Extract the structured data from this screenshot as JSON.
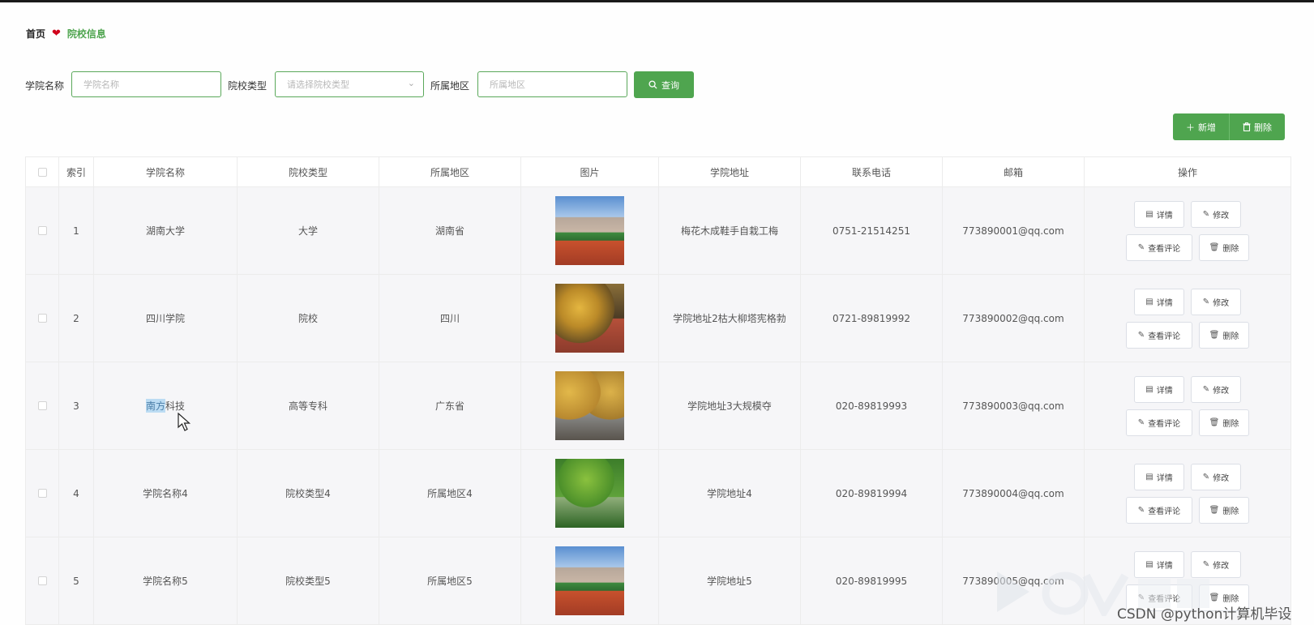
{
  "breadcrumb": {
    "home": "首页",
    "current": "院校信息"
  },
  "search": {
    "name_label": "学院名称",
    "name_placeholder": "学院名称",
    "type_label": "院校类型",
    "type_placeholder": "请选择院校类型",
    "region_label": "所属地区",
    "region_placeholder": "所属地区",
    "query_button": "查询"
  },
  "toolbar": {
    "add_button": "新增",
    "delete_button": "删除"
  },
  "table": {
    "columns": [
      "索引",
      "学院名称",
      "院校类型",
      "所属地区",
      "图片",
      "学院地址",
      "联系电话",
      "邮箱",
      "操作"
    ],
    "rows": [
      {
        "index": "1",
        "name": "湖南大学",
        "type": "大学",
        "region": "湖南省",
        "image": "campus",
        "address": "梅花木成鞋手自栽工梅",
        "phone": "0751-21514251",
        "email": "773890001@qq.com"
      },
      {
        "index": "2",
        "name": "四川学院",
        "type": "院校",
        "region": "四川",
        "image": "autumn",
        "address": "学院地址2枯大柳塔宪格勃",
        "phone": "0721-89819992",
        "email": "773890002@qq.com"
      },
      {
        "index": "3",
        "name_highlight": "南方",
        "name_rest": "科技",
        "type": "高等专科",
        "region": "广东省",
        "image": "road",
        "address": "学院地址3大规模夺",
        "phone": "020-89819993",
        "email": "773890003@qq.com"
      },
      {
        "index": "4",
        "name": "学院名称4",
        "type": "院校类型4",
        "region": "所属地区4",
        "image": "green",
        "address": "学院地址4",
        "phone": "020-89819994",
        "email": "773890004@qq.com"
      },
      {
        "index": "5",
        "name": "学院名称5",
        "type": "院校类型5",
        "region": "所属地区5",
        "image": "campus",
        "address": "学院地址5",
        "phone": "020-89819995",
        "email": "773890005@qq.com"
      }
    ],
    "row_actions": {
      "detail": "详情",
      "edit": "修改",
      "review": "查看评论",
      "delete": "删除"
    }
  },
  "watermark": {
    "text": "CSDN @python计算机毕设"
  },
  "colors": {
    "accent": "#4fa54f",
    "heart": "#d0021b",
    "row_bg": "#f6f6f8"
  }
}
